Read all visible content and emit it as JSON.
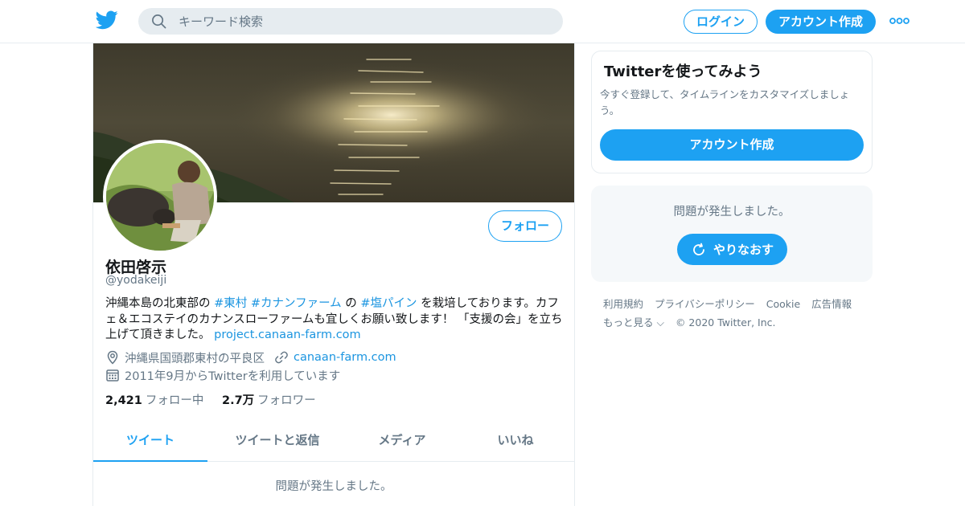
{
  "colors": {
    "accent": "#1da1f2",
    "link": "#1b95e0",
    "secondary_text": "#657786",
    "border": "#e6ecf0"
  },
  "header": {
    "logo_icon": "twitter-bird-icon",
    "search_placeholder": "キーワード検索",
    "login_label": "ログイン",
    "signup_label": "アカウント作成",
    "more_icon": "more-dots-icon"
  },
  "profile": {
    "display_name": "依田啓示",
    "handle": "@yodakeiji",
    "follow_label": "フォロー",
    "bio": {
      "part1": "沖縄本島の北東部の ",
      "tag1": "#東村",
      "space1": " ",
      "tag2": "#カナンファーム",
      "part2": " の ",
      "tag3": "#塩パイン",
      "part3": " を栽培しております。カフェ＆エコステイのカナンスローファームも宜しくお願い致します！ 「支援の会」を立ち上げて頂きました。 ",
      "url": "project.canaan-farm.com"
    },
    "location": "沖縄県国頭郡東村の平良区",
    "website": "canaan-farm.com",
    "joined": "2011年9月からTwitterを利用しています",
    "following_count": "2,421",
    "following_label": "フォロー中",
    "followers_count": "2.7万",
    "followers_label": "フォロワー",
    "tabs": [
      {
        "label": "ツイート",
        "active": true
      },
      {
        "label": "ツイートと返信",
        "active": false
      },
      {
        "label": "メディア",
        "active": false
      },
      {
        "label": "いいね",
        "active": false
      }
    ],
    "error_text": "問題が発生しました。"
  },
  "sidebar": {
    "card_title": "Twitterを使ってみよう",
    "card_desc": "今すぐ登録して、タイムラインをカスタマイズしましょう。",
    "card_button": "アカウント作成",
    "error_text": "問題が発生しました。",
    "retry_label": "やりなおす",
    "footer_links": [
      "利用規約",
      "プライバシーポリシー",
      "Cookie",
      "広告情報",
      "もっと見る ⌵"
    ],
    "copyright": "© 2020 Twitter, Inc."
  }
}
